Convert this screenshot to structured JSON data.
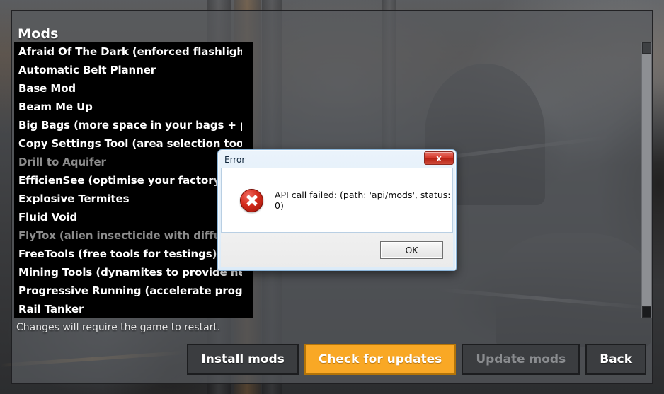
{
  "colors": {
    "accent": "#f9a825",
    "panel_bg": "#585a5e",
    "list_bg": "#000000",
    "disabled_text": "#8c8c8c",
    "error_red": "#d42b1c",
    "dialog_titlebar": "#dcebf8"
  },
  "panel": {
    "title": "Mods",
    "status_note": "Changes will require the game to restart."
  },
  "mod_list": {
    "items": [
      {
        "label": "Afraid Of The Dark (enforced flashlight an",
        "enabled": true
      },
      {
        "label": "Automatic Belt Planner",
        "enabled": true
      },
      {
        "label": "Base Mod",
        "enabled": true
      },
      {
        "label": "Beam Me Up",
        "enabled": true
      },
      {
        "label": "Big Bags (more space in your bags + pickst",
        "enabled": true
      },
      {
        "label": "Copy Settings Tool (area selection tool to",
        "enabled": true
      },
      {
        "label": "Drill to Aquifer",
        "enabled": false
      },
      {
        "label": "EfficienSee (optimise your factory !)",
        "enabled": true
      },
      {
        "label": "Explosive Termites",
        "enabled": true
      },
      {
        "label": "Fluid Void",
        "enabled": true
      },
      {
        "label": "FlyTox (alien insecticide with diffusors",
        "enabled": false
      },
      {
        "label": "FreeTools (free tools for testings)",
        "enabled": true
      },
      {
        "label": "Mining Tools (dynamites to provide new re",
        "enabled": true
      },
      {
        "label": "Progressive Running (accelerate progressi",
        "enabled": true
      },
      {
        "label": "Rail Tanker",
        "enabled": true
      }
    ],
    "scrollbar": {
      "up_icon": "scroll-up-thumb",
      "down_icon": "scroll-down-thumb"
    }
  },
  "buttons": [
    {
      "label": "Install mods",
      "style": "normal"
    },
    {
      "label": "Check for updates",
      "style": "accent"
    },
    {
      "label": "Update mods",
      "style": "disabled"
    },
    {
      "label": "Back",
      "style": "normal"
    }
  ],
  "error_dialog": {
    "title": "Error",
    "close_label": "x",
    "close_icon": "close-icon",
    "icon": "error-circle-x-icon",
    "message": "API call failed: (path: 'api/mods', status: 0)",
    "ok_label": "OK"
  }
}
